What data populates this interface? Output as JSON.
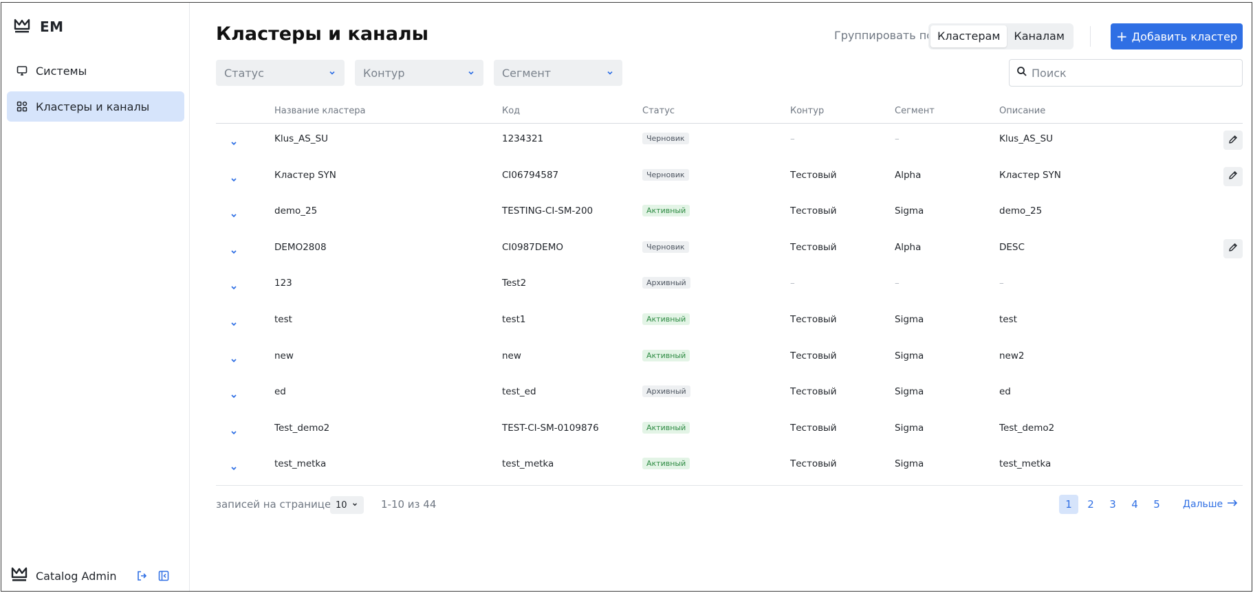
{
  "brand": {
    "name": "EM"
  },
  "sidebar": {
    "items": [
      {
        "label": "Системы",
        "icon": "monitor-icon"
      },
      {
        "label": "Кластеры и каналы",
        "icon": "grid-icon"
      }
    ],
    "user": {
      "name": "Catalog Admin"
    }
  },
  "header": {
    "title": "Кластеры и каналы",
    "group_by_label": "Группировать по",
    "group_options": [
      "Кластерам",
      "Каналам"
    ],
    "group_selected": "Кластерам",
    "add_button": "Добавить кластер"
  },
  "filters": {
    "status": "Статус",
    "contour": "Контур",
    "segment": "Сегмент",
    "search_placeholder": "Поиск"
  },
  "table": {
    "columns": [
      "Название кластера",
      "Код",
      "Статус",
      "Контур",
      "Сегмент",
      "Описание"
    ],
    "rows": [
      {
        "name": "Klus_AS_SU",
        "code": "1234321",
        "status": "Черновик",
        "contour": "–",
        "segment": "–",
        "description": "Klus_AS_SU",
        "editable": true
      },
      {
        "name": "Кластер SYN",
        "code": "CI06794587",
        "status": "Черновик",
        "contour": "Тестовый",
        "segment": "Alpha",
        "description": "Кластер SYN",
        "editable": true
      },
      {
        "name": "demo_25",
        "code": "TESTING-CI-SM-200",
        "status": "Активный",
        "contour": "Тестовый",
        "segment": "Sigma",
        "description": "demo_25",
        "editable": false
      },
      {
        "name": "DEMO2808",
        "code": "CI0987DEMO",
        "status": "Черновик",
        "contour": "Тестовый",
        "segment": "Alpha",
        "description": "DESC",
        "editable": true
      },
      {
        "name": "123",
        "code": "Test2",
        "status": "Архивный",
        "contour": "–",
        "segment": "–",
        "description": "–",
        "editable": false
      },
      {
        "name": "test",
        "code": "test1",
        "status": "Активный",
        "contour": "Тестовый",
        "segment": "Sigma",
        "description": "test",
        "editable": false
      },
      {
        "name": "new",
        "code": "new",
        "status": "Активный",
        "contour": "Тестовый",
        "segment": "Sigma",
        "description": "new2",
        "editable": false
      },
      {
        "name": "ed",
        "code": "test_ed",
        "status": "Архивный",
        "contour": "Тестовый",
        "segment": "Sigma",
        "description": "ed",
        "editable": false
      },
      {
        "name": "Test_demo2",
        "code": "TEST-CI-SM-0109876",
        "status": "Активный",
        "contour": "Тестовый",
        "segment": "Sigma",
        "description": "Test_demo2",
        "editable": false
      },
      {
        "name": "test_metka",
        "code": "test_metka",
        "status": "Активный",
        "contour": "Тестовый",
        "segment": "Sigma",
        "description": "test_metka",
        "editable": false
      }
    ]
  },
  "pagination": {
    "per_page_label": "записей на странице",
    "per_page": "10",
    "range": "1-10 из 44",
    "pages": [
      "1",
      "2",
      "3",
      "4",
      "5"
    ],
    "current": "1",
    "next_label": "Дальше"
  },
  "colors": {
    "accent": "#2f6fe4",
    "active_nav": "#d6e4fb",
    "badge_active_bg": "#e3f4e6",
    "badge_active_text": "#2e8b43"
  }
}
